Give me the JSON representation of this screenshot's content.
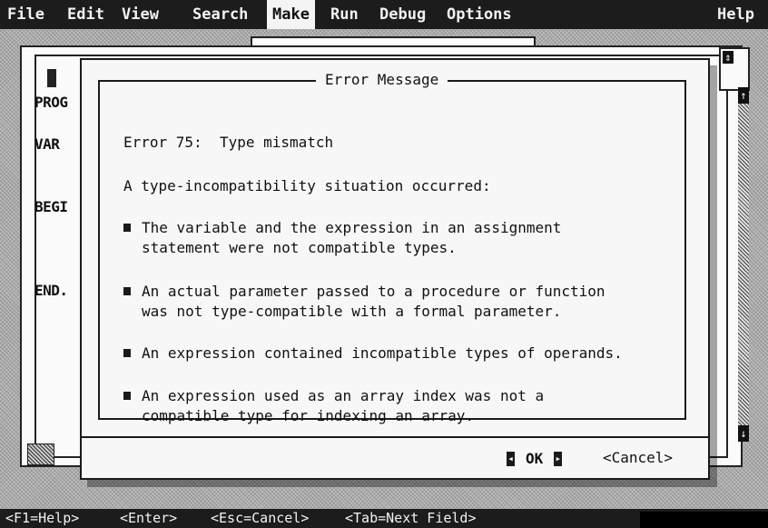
{
  "menu": {
    "items": [
      "File",
      "Edit",
      "View",
      "Search",
      "Make",
      "Run",
      "Debug",
      "Options"
    ],
    "active": "Make",
    "help": "Help"
  },
  "editor": {
    "code_lines": [
      "PROG",
      "VAR",
      "BEGI",
      "END."
    ]
  },
  "dialog": {
    "title": "Error Message",
    "error_line": "Error 75:  Type mismatch",
    "intro": "A type-incompatibility situation occurred:",
    "bullets": [
      [
        "The variable and the expression in an assignment",
        "statement were not compatible types."
      ],
      [
        "An actual parameter passed to a procedure or function",
        "was not type-compatible with a formal parameter."
      ],
      [
        "An expression contained incompatible types of operands."
      ],
      [
        "An expression used as an array index was not a",
        "compatible type for indexing an array."
      ]
    ],
    "ok_label": "OK",
    "cancel_label": "<Cancel>"
  },
  "status": {
    "items": [
      "<F1=Help>",
      "<Enter>",
      "<Esc=Cancel>",
      "<Tab=Next Field>"
    ]
  }
}
